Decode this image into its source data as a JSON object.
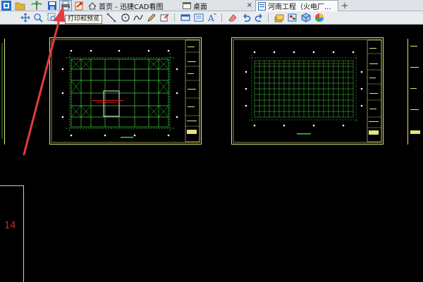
{
  "tabs": [
    {
      "label": "首页 - 迅捷CAD看图",
      "icon": "home-icon",
      "active": false
    },
    {
      "label": "桌面",
      "icon": "window-icon",
      "active": false
    },
    {
      "label": "河南工程（火电厂...",
      "icon": "document-icon",
      "active": true
    }
  ],
  "tab_close_glyph": "×",
  "tab_new_glyph": "+",
  "tooltip": {
    "text": "打印和预览"
  },
  "toolbar": {
    "top_icons": [
      "open-folder-icon",
      "palm-tree-icon",
      "save-icon",
      "print-icon",
      "export-icon"
    ],
    "row2_icons": [
      "pan-icon",
      "zoom-in-icon",
      "zoom-window-icon",
      "line-icon",
      "circle-icon",
      "spline-icon",
      "pencil-icon",
      "text-edit-icon",
      "rectangle-icon",
      "measure-icon",
      "text-style-icon",
      "eraser-icon",
      "undo-icon",
      "redo-icon",
      "layers-icon",
      "layer-properties-icon",
      "cube-icon",
      "color-wheel-icon"
    ]
  },
  "sheets": [
    {
      "name": "sheet-structure-plan",
      "annotation": "red-marker-text"
    },
    {
      "name": "sheet-grid-plan"
    }
  ],
  "lower_sheet_number": "14",
  "colors": {
    "canvas": "#000000",
    "sheet_border": "#e6e27a",
    "structure_lines": "#3ed13e",
    "red_lines": "#d02020",
    "arrow": "#e23c3c"
  }
}
